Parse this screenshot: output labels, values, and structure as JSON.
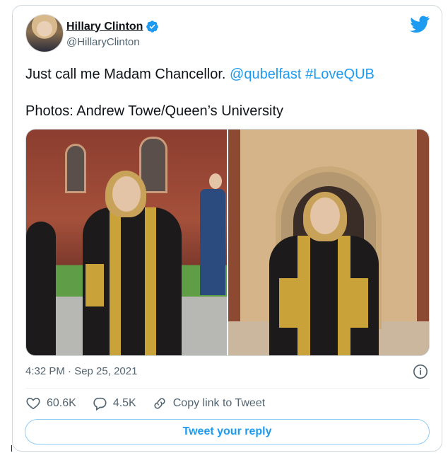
{
  "author": {
    "name": "Hillary Clinton",
    "handle": "@HillaryClinton",
    "verified": true
  },
  "tweet": {
    "text_prefix": "Just call me Madam Chancellor.",
    "mention": "@qubelfast",
    "hashtag": "#LoveQUB",
    "credit": "Photos: Andrew Towe/Queen’s University",
    "timestamp": "4:32 PM · Sep 25, 2021"
  },
  "stats": {
    "likes": "60.6K",
    "replies": "4.5K",
    "copy_link_label": "Copy link to Tweet"
  },
  "reply_button_label": "Tweet your reply",
  "colors": {
    "accent": "#1d9bf0",
    "text": "#0f1419",
    "muted": "#536471",
    "border": "#cfd9de"
  },
  "icons": [
    "verified-badge-icon",
    "twitter-bird-icon",
    "info-icon",
    "heart-icon",
    "reply-bubble-icon",
    "link-icon"
  ]
}
